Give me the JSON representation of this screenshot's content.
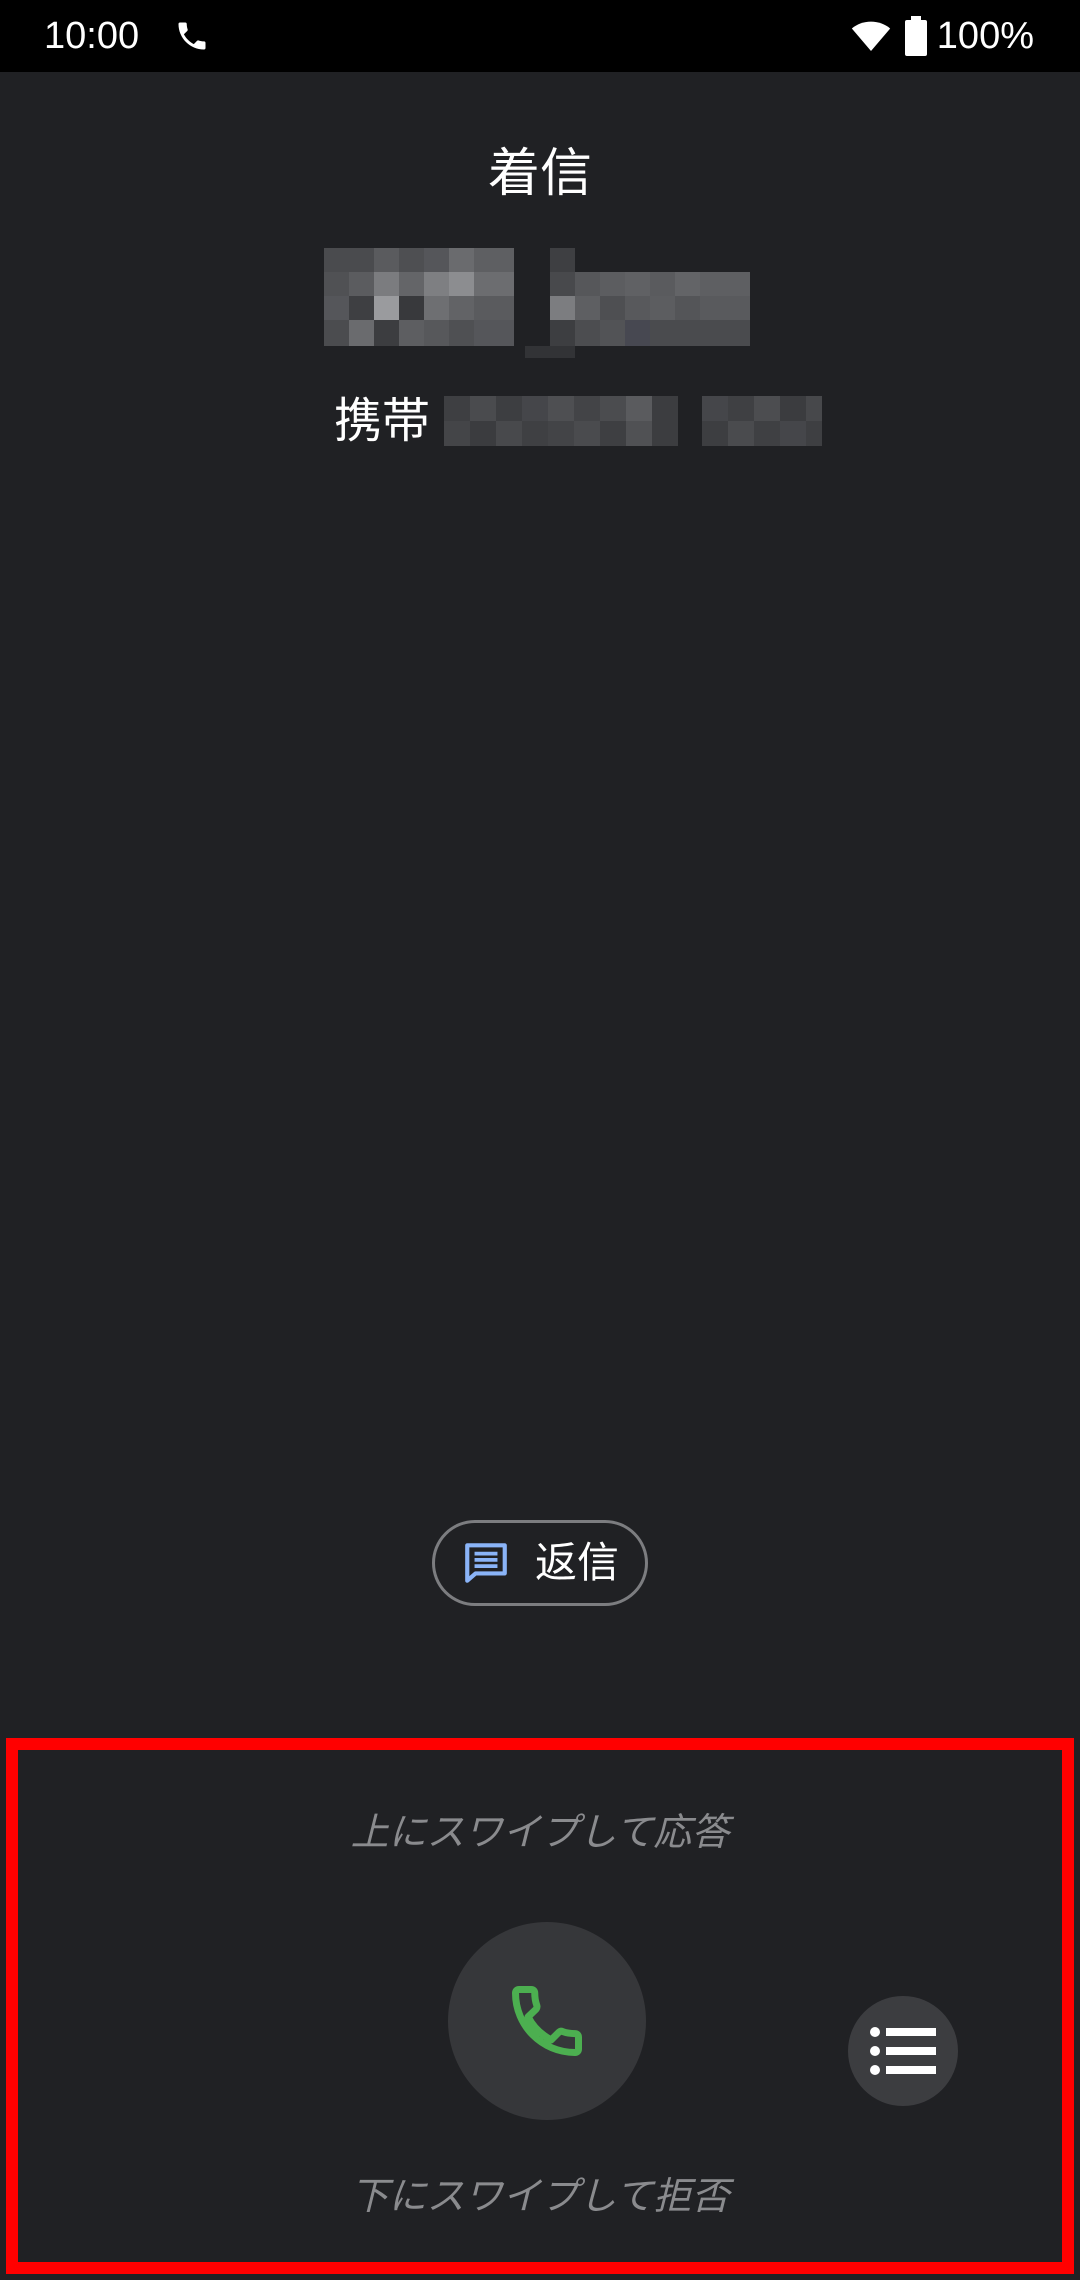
{
  "status_bar": {
    "time": "10:00",
    "call_icon": "phone-icon",
    "wifi_icon": "wifi-icon",
    "battery_icon": "battery-full-icon",
    "battery_percent": "100%"
  },
  "call": {
    "status": "着信",
    "caller_name_redacted": true,
    "number_label": "携帯",
    "number_redacted": true
  },
  "reply": {
    "icon": "message-icon",
    "label": "返信"
  },
  "answer_panel": {
    "swipe_up_hint": "上にスワイプして応答",
    "swipe_down_hint": "下にスワイプして拒否",
    "answer_icon": "phone-icon",
    "more_icon": "list-icon"
  },
  "colors": {
    "background": "#202124",
    "status_bar": "#000000",
    "answer_green": "#4caf50",
    "reply_icon_blue": "#8ab4f8",
    "highlight_frame": "#ff0000",
    "hint_text": "#8a8b8e"
  }
}
